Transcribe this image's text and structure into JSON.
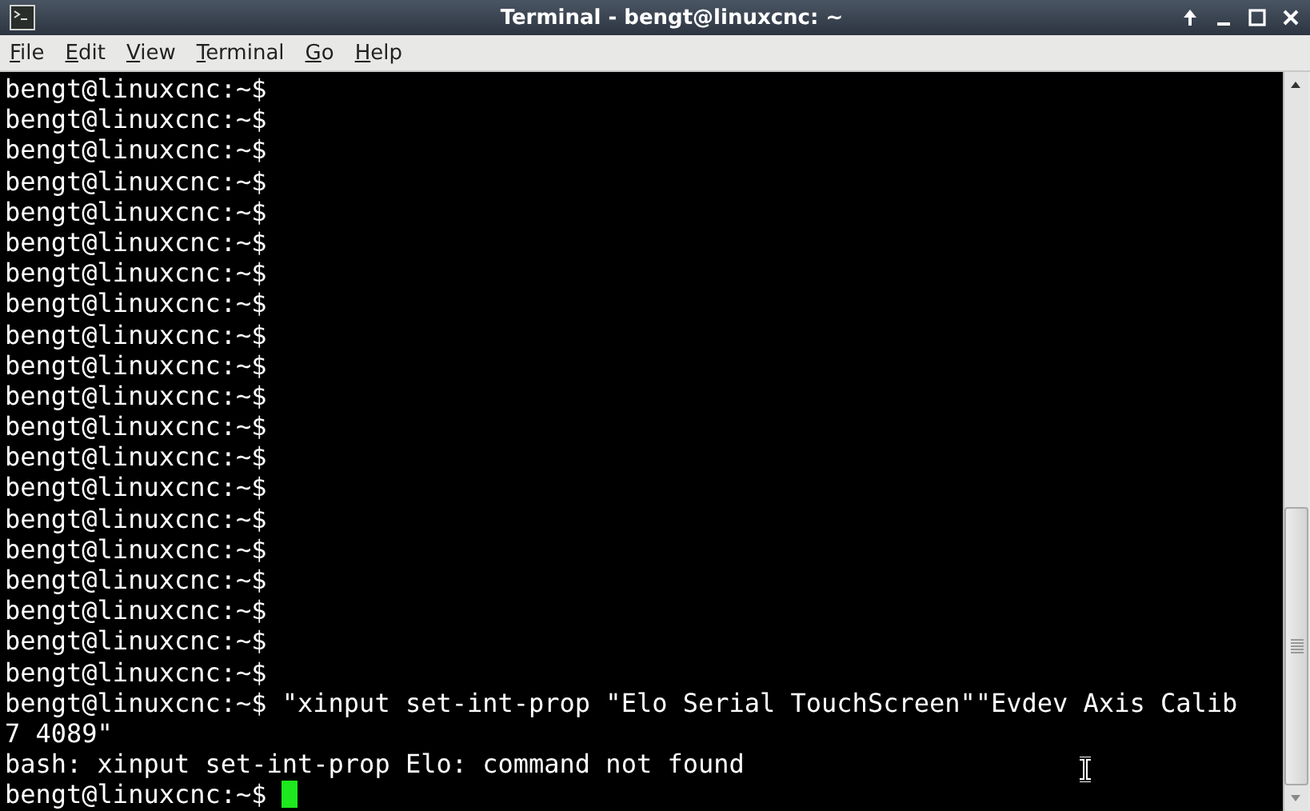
{
  "window": {
    "title": "Terminal - bengt@linuxcnc: ~"
  },
  "menu": [
    {
      "label": "File",
      "mnemonic_underlined": true
    },
    {
      "label": "Edit",
      "mnemonic_underlined": true
    },
    {
      "label": "View",
      "mnemonic_underlined": true
    },
    {
      "label": "Terminal",
      "mnemonic_underlined": true
    },
    {
      "label": "Go",
      "mnemonic_underlined": true
    },
    {
      "label": "Help",
      "mnemonic_underlined": true
    }
  ],
  "terminal": {
    "cursor_visible": true,
    "lines": [
      "bengt@linuxcnc:~$",
      "bengt@linuxcnc:~$",
      "bengt@linuxcnc:~$",
      "bengt@linuxcnc:~$",
      "bengt@linuxcnc:~$",
      "bengt@linuxcnc:~$",
      "bengt@linuxcnc:~$",
      "bengt@linuxcnc:~$",
      "bengt@linuxcnc:~$",
      "bengt@linuxcnc:~$",
      "bengt@linuxcnc:~$",
      "bengt@linuxcnc:~$",
      "bengt@linuxcnc:~$",
      "bengt@linuxcnc:~$",
      "bengt@linuxcnc:~$",
      "bengt@linuxcnc:~$",
      "bengt@linuxcnc:~$",
      "bengt@linuxcnc:~$",
      "bengt@linuxcnc:~$",
      "bengt@linuxcnc:~$",
      "bengt@linuxcnc:~$ \"xinput set-int-prop \"Elo Serial TouchScreen\"\"Evdev Axis Calib",
      "7 4089\"",
      "bash: xinput set-int-prop Elo: command not found",
      "bengt@linuxcnc:~$ "
    ]
  }
}
